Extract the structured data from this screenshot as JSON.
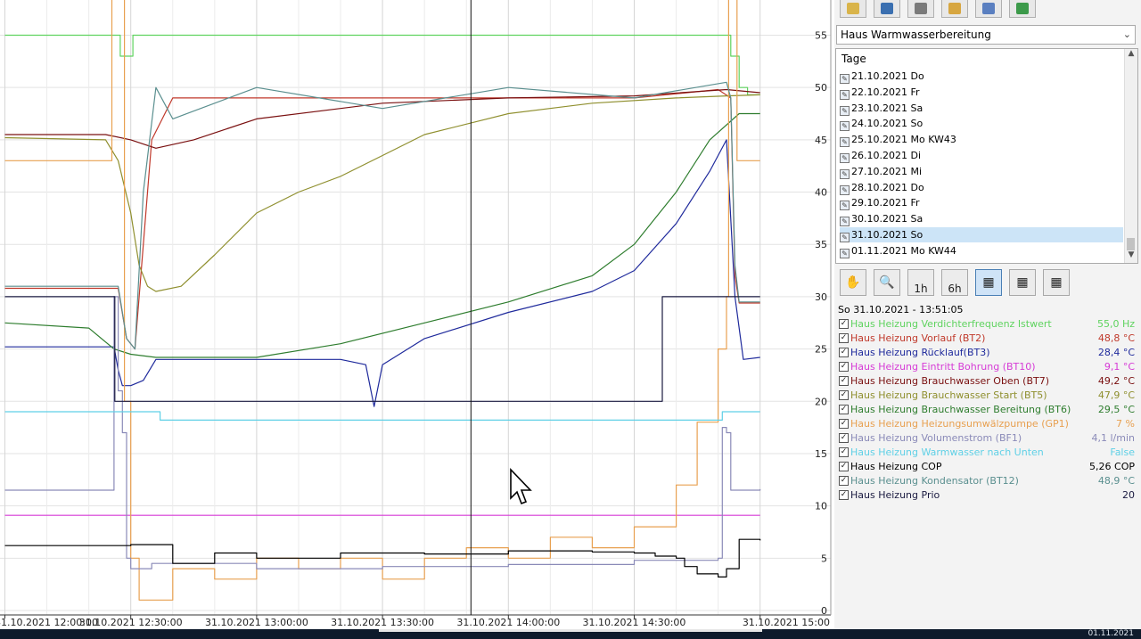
{
  "window": {
    "dropdown_value": "Haus Warmwasserbereitung",
    "days_header": "Tage",
    "days": [
      "21.10.2021 Do",
      "22.10.2021 Fr",
      "23.10.2021 Sa",
      "24.10.2021 So",
      "25.10.2021 Mo KW43",
      "26.10.2021 Di",
      "27.10.2021 Mi",
      "28.10.2021 Do",
      "29.10.2021 Fr",
      "30.10.2021 Sa",
      "31.10.2021 So",
      "01.11.2021 Mo KW44"
    ],
    "selected_day": "31.10.2021 So",
    "toolbar_icons": [
      "folder-icon",
      "settings-icon",
      "print-icon",
      "mail-icon",
      "edit-icon",
      "export-icon"
    ],
    "view_tools": [
      {
        "name": "hand-tool",
        "label": ""
      },
      {
        "name": "zoom-tool",
        "label": ""
      },
      {
        "name": "zoom-1h",
        "label": "1h"
      },
      {
        "name": "zoom-6h",
        "label": "6h"
      },
      {
        "name": "day-view",
        "label": ""
      },
      {
        "name": "week-view",
        "label": ""
      },
      {
        "name": "month-view",
        "label": ""
      }
    ],
    "timestamp": "So 31.10.2021 - 13:51:05",
    "taskbar_date": "01.11.2021",
    "colors": {
      "selected_row": "#cce4f7",
      "panel_bg": "#f3f3f3"
    }
  },
  "legend": [
    {
      "name": "Haus Heizung Verdichterfrequenz Istwert",
      "value": "55,0 Hz",
      "color": "#5fd35f"
    },
    {
      "name": "Haus Heizung Vorlauf (BT2)",
      "value": "48,8 °C",
      "color": "#c0392b"
    },
    {
      "name": "Haus Heizung Rücklauf(BT3)",
      "value": "28,4 °C",
      "color": "#1f2a9c"
    },
    {
      "name": "Haus Heizung Eintritt Bohrung (BT10)",
      "value": "9,1 °C",
      "color": "#d63ad6"
    },
    {
      "name": "Haus Heizung Brauchwasser Oben (BT7)",
      "value": "49,2 °C",
      "color": "#7a1010"
    },
    {
      "name": "Haus Heizung Brauchwasser Start (BT5)",
      "value": "47,9 °C",
      "color": "#8f8f2e"
    },
    {
      "name": "Haus Heizung Brauchwasser Bereitung (BT6)",
      "value": "29,5 °C",
      "color": "#2e7d2e"
    },
    {
      "name": "Haus Heizung Heizungsumwälzpumpe (GP1)",
      "value": "7 %",
      "color": "#e8a050"
    },
    {
      "name": "Haus Heizung Volumenstrom (BF1)",
      "value": "4,1 l/min",
      "color": "#8a8ab8"
    },
    {
      "name": "Haus Heizung Warmwasser nach Unten",
      "value": "False",
      "color": "#5fd0e6"
    },
    {
      "name": "Haus Heizung COP",
      "value": "5,26 COP",
      "color": "#000000"
    },
    {
      "name": "Haus Heizung Kondensator (BT12)",
      "value": "48,9 °C",
      "color": "#5a8f8f"
    },
    {
      "name": "Haus Heizung Prio",
      "value": "20",
      "color": "#1a1a40"
    }
  ],
  "chart_data": {
    "type": "line",
    "title": "",
    "xlabel": "",
    "ylabel": "",
    "x_ticks": [
      "31.10.2021 12:00:00",
      "31.10.2021 12:30:00",
      "31.10.2021 13:00:00",
      "31.10.2021 13:30:00",
      "31.10.2021 14:00:00",
      "31.10.2021 14:30:00",
      "31.10.2021 15:00"
    ],
    "x_range": [
      "31.10.2021 12:00:00",
      "31.10.2021 15:00"
    ],
    "y_ticks": [
      0,
      5,
      10,
      15,
      20,
      25,
      30,
      35,
      40,
      45,
      50,
      55
    ],
    "ylim": [
      0,
      59
    ],
    "grid": true,
    "cursor_time": "31.10.2021 13:51:05",
    "series": [
      {
        "name": "Haus Heizung Verdichterfrequenz Istwert",
        "color": "#5fd35f",
        "x": [
          0,
          27,
          27.5,
          30,
          30.5,
          172,
          173,
          175,
          177,
          180
        ],
        "y": [
          55,
          55,
          53,
          53,
          55,
          55,
          53,
          50,
          49.3,
          49.3
        ]
      },
      {
        "name": "Haus Heizung Vorlauf (BT2)",
        "color": "#c0392b",
        "x": [
          0,
          27,
          29,
          31,
          33,
          35,
          40,
          60,
          90,
          120,
          150,
          170,
          173,
          174,
          175,
          180
        ],
        "y": [
          30.8,
          30.8,
          26,
          25,
          35,
          45,
          49,
          49,
          49,
          49,
          49,
          49.8,
          49,
          32,
          29.4,
          29.4
        ]
      },
      {
        "name": "Haus Heizung Rücklauf(BT3)",
        "color": "#1f2a9c",
        "x": [
          0,
          26,
          27,
          28,
          30,
          33,
          36,
          60,
          80,
          86,
          88,
          90,
          100,
          120,
          140,
          150,
          160,
          168,
          172,
          174,
          176,
          180
        ],
        "y": [
          25.2,
          25.2,
          23,
          21.5,
          21.5,
          22,
          24,
          24,
          24,
          23.5,
          19.5,
          23.5,
          26,
          28.5,
          30.5,
          32.5,
          37,
          42,
          45,
          30,
          24,
          24.2
        ]
      },
      {
        "name": "Haus Heizung Eintritt Bohrung (BT10)",
        "color": "#d63ad6",
        "x": [
          0,
          180
        ],
        "y": [
          9.1,
          9.1
        ]
      },
      {
        "name": "Haus Heizung Brauchwasser Oben (BT7)",
        "color": "#7a1010",
        "x": [
          0,
          24,
          30,
          36,
          45,
          60,
          90,
          120,
          150,
          172,
          180
        ],
        "y": [
          45.5,
          45.5,
          45,
          44.2,
          45,
          47,
          48.5,
          49,
          49.2,
          49.8,
          49.5
        ]
      },
      {
        "name": "Haus Heizung Brauchwasser Start (BT5)",
        "color": "#8f8f2e",
        "x": [
          0,
          24,
          27,
          30,
          32,
          34,
          36,
          42,
          50,
          60,
          70,
          80,
          90,
          100,
          120,
          140,
          160,
          172,
          180
        ],
        "y": [
          45.2,
          45,
          43,
          38,
          33,
          31,
          30.5,
          31,
          34,
          38,
          40,
          41.5,
          43.5,
          45.5,
          47.5,
          48.5,
          49,
          49.2,
          49.3
        ]
      },
      {
        "name": "Haus Heizung Brauchwasser Bereitung (BT6)",
        "color": "#2e7d2e",
        "x": [
          0,
          20,
          26,
          30,
          36,
          60,
          80,
          100,
          120,
          140,
          150,
          160,
          168,
          175,
          180
        ],
        "y": [
          27.5,
          27,
          25,
          24.5,
          24.2,
          24.2,
          25.5,
          27.5,
          29.5,
          32,
          35,
          40,
          45,
          47.5,
          47.5
        ]
      },
      {
        "name": "Haus Heizung Heizungsumwälzpumpe (GP1)",
        "color": "#e8a050",
        "x": [
          0,
          25,
          25.5,
          28,
          28.5,
          30,
          32,
          40,
          50,
          60,
          70,
          80,
          90,
          100,
          110,
          120,
          130,
          140,
          150,
          160,
          165,
          170,
          172,
          172.5,
          174,
          174.5,
          180
        ],
        "y": [
          43,
          43,
          60,
          60,
          20,
          5,
          1,
          4,
          3,
          5,
          4,
          5,
          3,
          5,
          6,
          5,
          7,
          6,
          8,
          12,
          18,
          25,
          30,
          60,
          60,
          43,
          43
        ]
      },
      {
        "name": "Haus Heizung Volumenstrom (BF1)",
        "color": "#8a8ab8",
        "x": [
          0,
          25,
          26,
          27,
          28,
          29,
          30,
          35,
          60,
          90,
          120,
          150,
          170,
          171,
          172,
          173,
          174,
          180
        ],
        "y": [
          11.5,
          11.5,
          30,
          21,
          17,
          5,
          4,
          4.5,
          4,
          4.2,
          4.4,
          4.8,
          5,
          17.5,
          17,
          11.5,
          11.5,
          11.6
        ]
      },
      {
        "name": "Haus Heizung Warmwasser nach Unten",
        "color": "#5fd0e6",
        "x": [
          0,
          36,
          37,
          170,
          171,
          180
        ],
        "y": [
          19,
          19,
          18.2,
          18.2,
          19,
          19
        ]
      },
      {
        "name": "Haus Heizung COP",
        "color": "#000000",
        "x": [
          0,
          28,
          30,
          40,
          50,
          60,
          80,
          100,
          120,
          140,
          150,
          155,
          160,
          162,
          165,
          170,
          172,
          175,
          180
        ],
        "y": [
          6.2,
          6.2,
          6.3,
          4.5,
          5.5,
          5,
          5.5,
          5.4,
          5.7,
          5.6,
          5.5,
          5.2,
          5,
          4.2,
          3.5,
          3.2,
          4,
          6.8,
          6.7
        ]
      },
      {
        "name": "Haus Heizung Kondensator (BT12)",
        "color": "#5a8f8f",
        "x": [
          0,
          27,
          29,
          31,
          33,
          36,
          40,
          60,
          90,
          120,
          150,
          172,
          173,
          174,
          175,
          180
        ],
        "y": [
          31,
          31,
          26,
          25,
          40,
          50,
          47,
          50,
          48,
          50,
          49,
          50.5,
          49,
          33,
          29.5,
          29.5
        ]
      },
      {
        "name": "Haus Heizung Prio",
        "color": "#1a1a40",
        "x": [
          0,
          26,
          26.2,
          156.5,
          156.7,
          180
        ],
        "y": [
          30,
          30,
          20,
          20,
          30,
          30
        ]
      }
    ]
  }
}
